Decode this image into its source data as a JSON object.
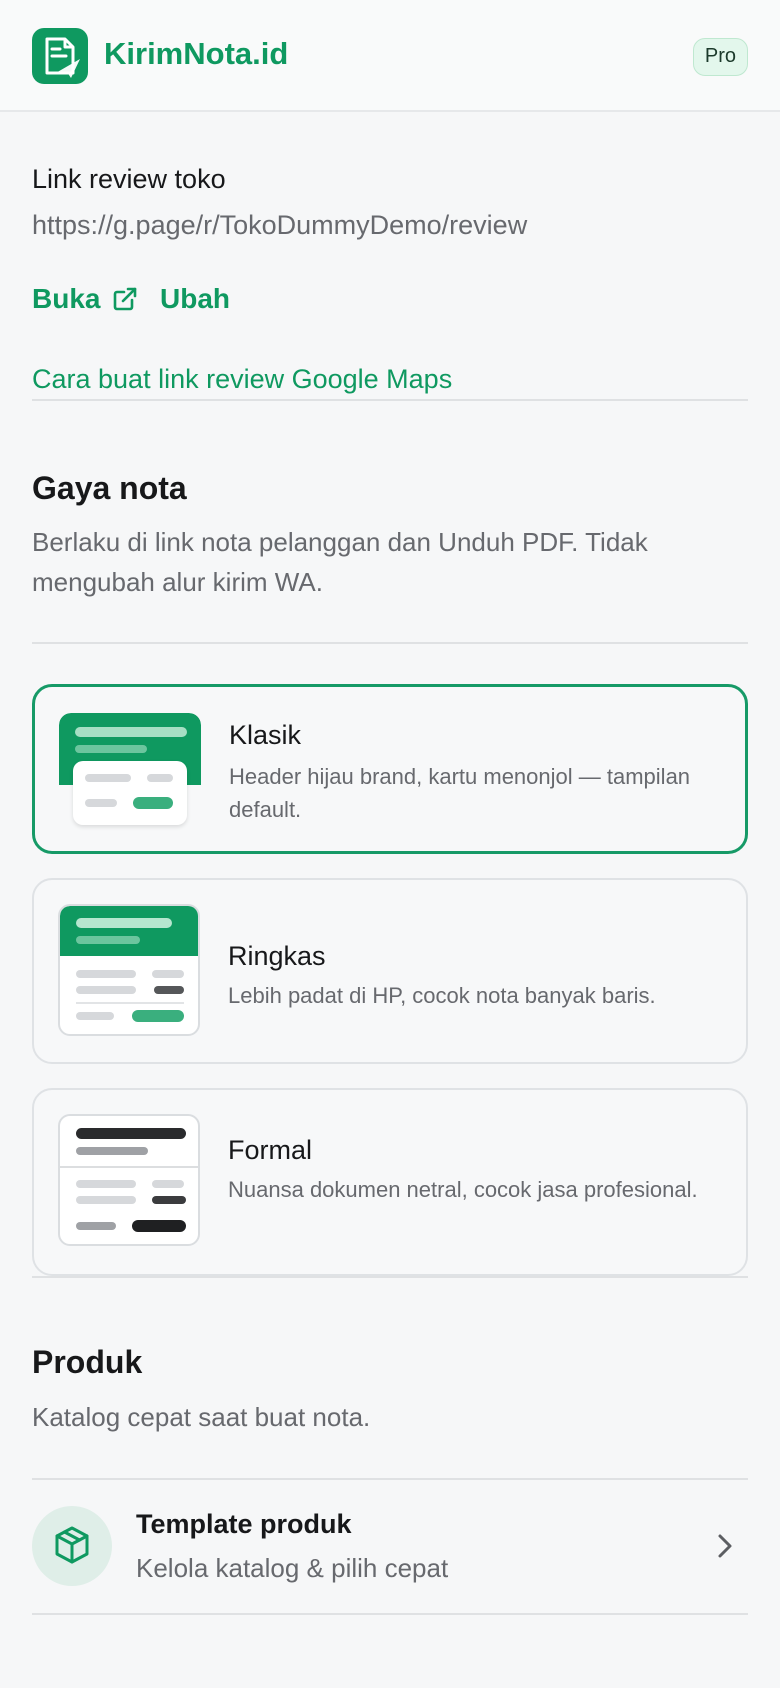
{
  "header": {
    "brand": "KirimNota.id",
    "badge": "Pro"
  },
  "review": {
    "label": "Link review toko",
    "url": "https://g.page/r/TokoDummyDemo/review",
    "open_label": "Buka",
    "edit_label": "Ubah",
    "help_link": "Cara buat link review Google Maps"
  },
  "style": {
    "title": "Gaya nota",
    "description": "Berlaku di link nota pelanggan dan Unduh PDF. Tidak mengubah alur kirim WA.",
    "selected": "Klasik",
    "options": [
      {
        "title": "Klasik",
        "desc": "Header hijau brand, kartu menonjol — tampilan default."
      },
      {
        "title": "Ringkas",
        "desc": "Lebih padat di HP, cocok nota banyak baris."
      },
      {
        "title": "Formal",
        "desc": "Nuansa dokumen netral, cocok jasa profesional."
      }
    ]
  },
  "products": {
    "title": "Produk",
    "description": "Katalog cepat saat buat nota.",
    "item_title": "Template produk",
    "item_desc": "Kelola katalog & pilih cepat"
  },
  "colors": {
    "brand": "#0f9960",
    "accent_border": "#169a67",
    "muted_text": "#67696e"
  },
  "icons": [
    "logo-icon",
    "external-link-icon",
    "package-icon",
    "chevron-right-icon"
  ]
}
